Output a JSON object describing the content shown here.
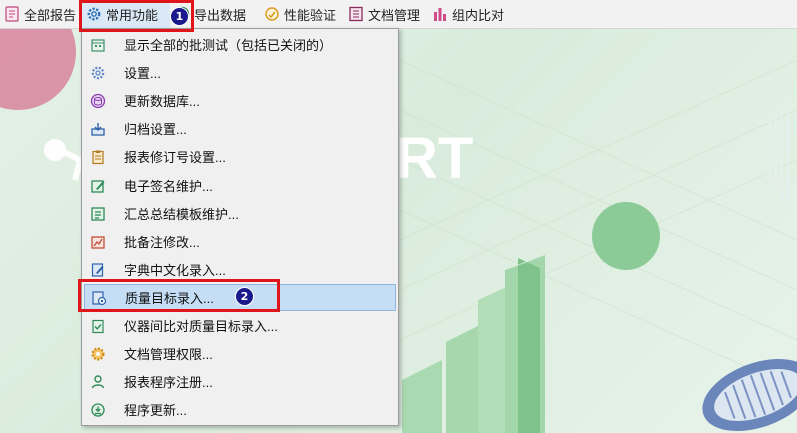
{
  "toolbar": {
    "items": [
      {
        "label": "全部报告",
        "icon": "report-icon"
      },
      {
        "label": "常用功能",
        "icon": "gear-icon"
      },
      {
        "label": "导出数据",
        "icon": "export-icon"
      },
      {
        "label": "性能验证",
        "icon": "performance-icon"
      },
      {
        "label": "文档管理",
        "icon": "document-icon"
      },
      {
        "label": "组内比对",
        "icon": "bar-chart-icon"
      }
    ]
  },
  "background": {
    "logo_text": "RT"
  },
  "menu": {
    "items": [
      {
        "label": "显示全部的批测试（包括已关闭的）",
        "icon": "calendar-icon"
      },
      {
        "label": "设置...",
        "icon": "settings-icon"
      },
      {
        "label": "更新数据库...",
        "icon": "database-icon"
      },
      {
        "label": "归档设置...",
        "icon": "archive-icon"
      },
      {
        "label": "报表修订号设置...",
        "icon": "clipboard-icon"
      },
      {
        "label": "电子签名维护...",
        "icon": "edit-signature-icon"
      },
      {
        "label": "汇总总结模板维护...",
        "icon": "template-icon"
      },
      {
        "label": "批备注修改...",
        "icon": "chart-note-icon"
      },
      {
        "label": "字典中文化录入...",
        "icon": "dictionary-edit-icon"
      },
      {
        "label": "质量目标录入...",
        "icon": "quality-target-icon"
      },
      {
        "label": "仪器间比对质量目标录入...",
        "icon": "check-clipboard-icon"
      },
      {
        "label": "文档管理权限...",
        "icon": "permission-gear-icon"
      },
      {
        "label": "报表程序注册...",
        "icon": "user-register-icon"
      },
      {
        "label": "程序更新...",
        "icon": "update-icon"
      }
    ],
    "highlighted_index": 9
  },
  "annotations": {
    "badge1": "1",
    "badge2": "2"
  },
  "colors": {
    "highlight": "#c5def5",
    "annotation_red": "#e0141b",
    "badge": "#1a1a8c"
  }
}
